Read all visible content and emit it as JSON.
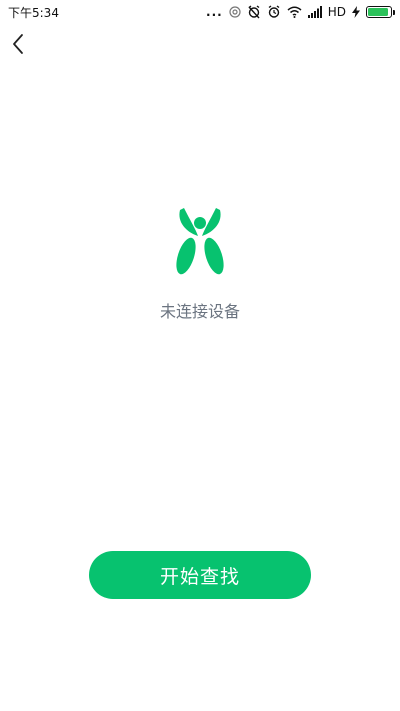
{
  "status_bar": {
    "time": "下午5:34",
    "dots": "...",
    "network_label": "HD",
    "battery_level": 0.92,
    "icons": [
      "location-icon",
      "alarm-off-icon",
      "alarm-icon",
      "wifi-icon",
      "signal-icon",
      "charging-icon",
      "battery-icon"
    ]
  },
  "header": {
    "back_icon": "chevron-left-icon"
  },
  "main": {
    "logo_icon": "device-logo-icon",
    "status_text": "未连接设备",
    "start_button_label": "开始查找"
  },
  "colors": {
    "accent": "#07c26f",
    "battery": "#2bc25a",
    "status_text": "#6b7480"
  }
}
